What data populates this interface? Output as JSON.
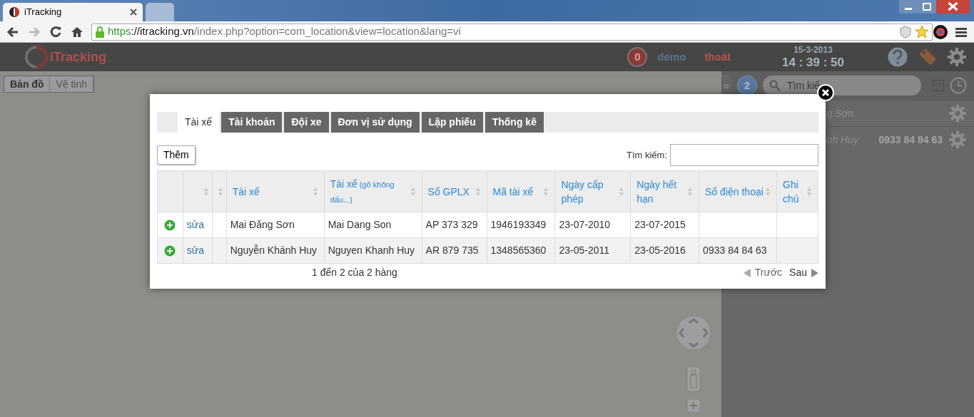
{
  "browser": {
    "tabs": [
      {
        "title": "iTracking",
        "selected": true
      },
      {
        "selected": false
      }
    ],
    "url": {
      "scheme": "https",
      "domain": "://itracking.vn",
      "path": "/index.php?option=com_location&view=location&lang=vi"
    }
  },
  "app_header": {
    "logo_text": "iTracking",
    "alert_count": "0",
    "username": "demo",
    "logout": "thoát",
    "date": "15-3-2013",
    "time": "14 : 39 : 50"
  },
  "map": {
    "type_buttons": [
      {
        "label": "Bản đồ",
        "selected": true
      },
      {
        "label": "Vệ tinh",
        "selected": false
      }
    ]
  },
  "side_panel": {
    "expand": "»",
    "count": "2",
    "search_placeholder": "Tìm kiế",
    "show_all_checked": false,
    "vehicles": [
      {
        "name": "g Sơn"
      },
      {
        "name": "nh Huy",
        "phone": "0933 84 84 63"
      }
    ]
  },
  "modal": {
    "tabs": [
      {
        "label": "Tài xế",
        "selected": true
      },
      {
        "label": "Tài khoản",
        "selected": false
      },
      {
        "label": "Đội xe",
        "selected": false
      },
      {
        "label": "Đơn vị sử dụng",
        "selected": false
      },
      {
        "label": "Lập phiếu",
        "selected": false
      },
      {
        "label": "Thống kê",
        "selected": false
      }
    ],
    "add_button": "Thêm",
    "search_label": "Tìm kiếm:",
    "table": {
      "columns": [
        {
          "label": "Tài xế"
        },
        {
          "label": "Tài xế",
          "note": "(gõ không dấu...)"
        },
        {
          "label": "Số GPLX"
        },
        {
          "label": "Mã tài xế"
        },
        {
          "label": "Ngày cấp phép"
        },
        {
          "label": "Ngày hết hạn"
        },
        {
          "label": "Số điện thoại"
        },
        {
          "label": "Ghi chú"
        }
      ],
      "rows": [
        {
          "edit": "sửa",
          "cells": [
            "Mai Đăng Sơn",
            "Mai Dang Son",
            "AP 373 329",
            "1946193349",
            "23-07-2010",
            "23-07-2015"
          ]
        },
        {
          "edit": "sửa",
          "cells": [
            "Nguyễn Khánh Huy",
            "Nguyen Khanh Huy",
            "AR 879 735",
            "1348565360",
            "23-05-2011",
            "23-05-2016",
            "0933 84 84 63"
          ]
        }
      ]
    },
    "info": "1 đến 2 của 2 hàng",
    "pagination": {
      "prev": {
        "label": "Trước",
        "disabled": true
      },
      "next": {
        "label": "Sau",
        "disabled": false
      }
    }
  }
}
